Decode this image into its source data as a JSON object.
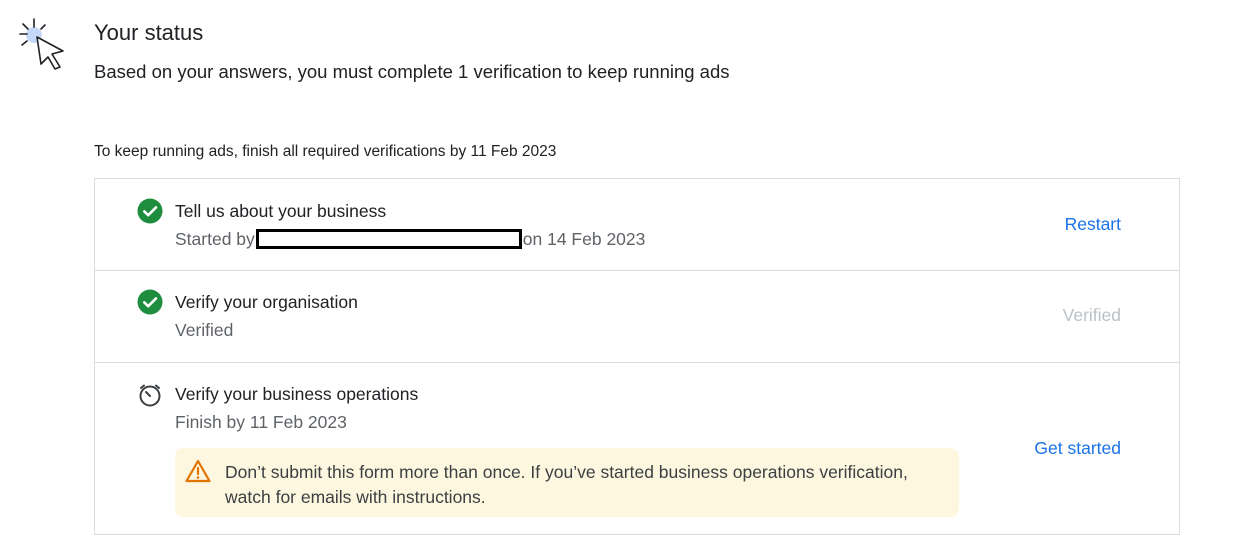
{
  "header": {
    "cursor_icon": "click-cursor-icon",
    "title": "Your status",
    "subtitle": "Based on your answers, you must complete 1 verification to keep running ads"
  },
  "deadline_text": "To keep running ads, finish all required verifications by 11 Feb 2023",
  "steps": [
    {
      "icon": "check-circle-icon",
      "title": "Tell us about your business",
      "sub_prefix": "Started by",
      "sub_suffix": "on 14 Feb 2023",
      "action": "Restart"
    },
    {
      "icon": "check-circle-icon",
      "title": "Verify your organisation",
      "sub": "Verified",
      "action": "Verified"
    },
    {
      "icon": "timer-icon",
      "title": "Verify your business operations",
      "sub": "Finish by 11 Feb 2023",
      "action": "Get started",
      "warning": {
        "icon": "warning-triangle-icon",
        "line1": "Don’t submit this form more than once. If you’ve started business operations verification,",
        "line2": "watch for emails with instructions."
      }
    }
  ],
  "colors": {
    "accent": "#1a73e8",
    "success": "#1e8e3e",
    "warning": "#e37400",
    "warning_bg": "#fef7e0",
    "disabled": "#bdc1c6"
  }
}
